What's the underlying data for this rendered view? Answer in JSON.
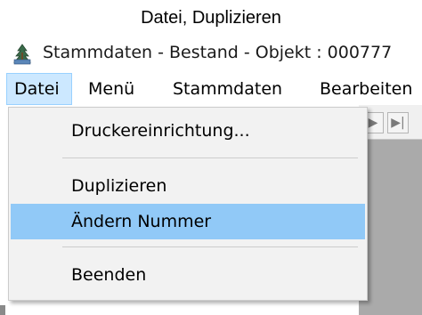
{
  "caption": "Datei, Duplizieren",
  "window": {
    "title": "Stammdaten - Bestand - Objekt : 000777",
    "icon": "app-tree-icon"
  },
  "menubar": {
    "items": [
      {
        "label": "Datei",
        "active": true
      },
      {
        "label": "Menü",
        "active": false
      },
      {
        "label": "Stammdaten",
        "active": false
      },
      {
        "label": "Bearbeiten",
        "active": false
      }
    ]
  },
  "toolbar": {
    "next_symbol": "▶",
    "last_symbol": "▶|"
  },
  "dropdown": {
    "items": [
      {
        "label": "Druckereinrichtung..."
      },
      {
        "label": "Duplizieren"
      },
      {
        "label": "Ändern Nummer",
        "highlighted": true
      },
      {
        "label": "Beenden"
      }
    ]
  },
  "colors": {
    "menu_active_bg": "#cce8ff",
    "item_highlight_bg": "#91c9f7",
    "dropdown_bg": "#f2f2f2",
    "workspace_bg": "#aaaaaa"
  }
}
